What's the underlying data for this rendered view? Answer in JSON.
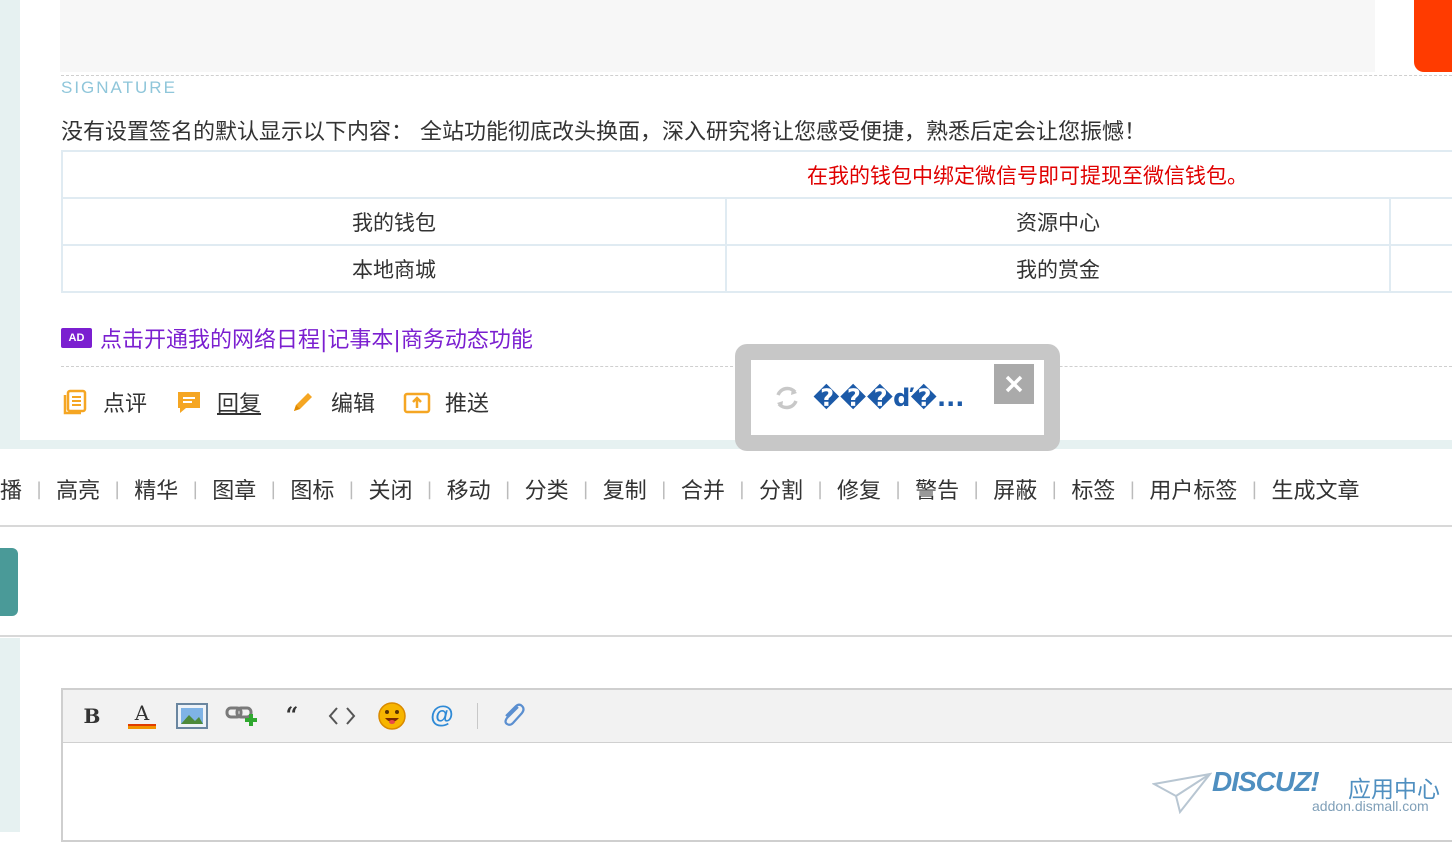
{
  "signature": {
    "label": "SIGNATURE",
    "default_text": "没有设置签名的默认显示以下内容： 全站功能彻底改头换面，深入研究将让您感受便捷，熟悉后定会让您振憾！",
    "notice": "在我的钱包中绑定微信号即可提现至微信钱包。",
    "links": [
      [
        "我的钱包",
        "资源中心",
        ""
      ],
      [
        "本地商城",
        "我的赏金",
        ""
      ]
    ]
  },
  "ad": {
    "badge": "AD",
    "text": "点击开通我的网络日程|记事本|商务动态功能"
  },
  "post_actions": [
    {
      "label": "点评",
      "icon": "comment-list-icon"
    },
    {
      "label": "回复",
      "icon": "reply-bubble-icon"
    },
    {
      "label": "编辑",
      "icon": "pencil-icon"
    },
    {
      "label": "推送",
      "icon": "push-upload-icon"
    }
  ],
  "loading_popup": {
    "text": "���ď�..."
  },
  "moderation_tools": [
    "播",
    "高亮",
    "精华",
    "图章",
    "图标",
    "关闭",
    "移动",
    "分类",
    "复制",
    "合并",
    "分割",
    "修复",
    "警告",
    "屏蔽",
    "标签",
    "用户标签",
    "生成文章"
  ],
  "editor_toolbar": [
    {
      "name": "bold-icon",
      "glyph": "B"
    },
    {
      "name": "font-color-icon",
      "glyph": "A"
    },
    {
      "name": "image-icon"
    },
    {
      "name": "link-add-icon"
    },
    {
      "name": "quote-icon",
      "glyph": "“"
    },
    {
      "name": "code-icon",
      "glyph": "<>"
    },
    {
      "name": "smiley-icon"
    },
    {
      "name": "mention-icon",
      "glyph": "@"
    },
    {
      "name": "attachment-icon"
    }
  ],
  "watermark": {
    "brand": "DISCUZ!",
    "cn": "应用中心",
    "url": "addon.dismall.com"
  },
  "colors": {
    "accent_orange": "#ff3b00",
    "ad_purple": "#7b1fd0",
    "notice_red": "#e00000",
    "teal": "#4a9a98",
    "icon_orange": "#f5a623"
  }
}
